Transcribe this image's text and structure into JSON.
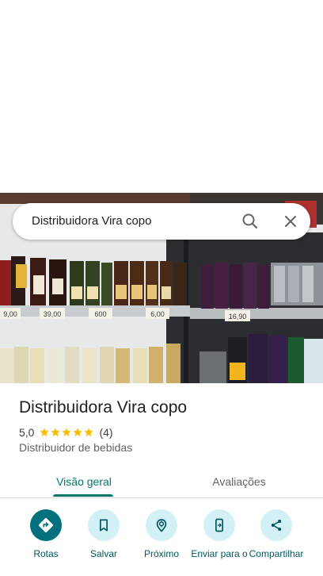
{
  "search": {
    "query": "Distribuidora Vira copo"
  },
  "place": {
    "title": "Distribuidora Vira copo",
    "rating_value": "5,0",
    "stars": 5,
    "review_count": "(4)",
    "category": "Distribuidor de bebidas"
  },
  "photo": {
    "price_tags": [
      "9,00",
      "39,00",
      "600",
      "6,00",
      "16,90"
    ]
  },
  "tabs": [
    {
      "label": "Visão geral",
      "selected": true
    },
    {
      "label": "Avaliações",
      "selected": false
    }
  ],
  "actions": [
    {
      "label": "Rotas",
      "icon": "directions-icon"
    },
    {
      "label": "Salvar",
      "icon": "bookmark-icon"
    },
    {
      "label": "Próximo",
      "icon": "nearby-icon"
    },
    {
      "label": "Enviar para o",
      "icon": "send-to-phone-icon"
    },
    {
      "label": "Compartilhar",
      "icon": "share-icon"
    }
  ],
  "colors": {
    "accent": "#00796b",
    "action_circle": "#d3f0f6",
    "primary_action": "#00707e",
    "star": "#fbbc04"
  }
}
